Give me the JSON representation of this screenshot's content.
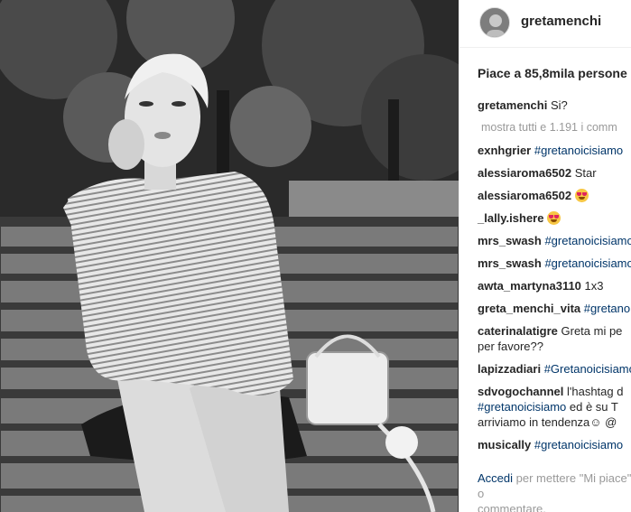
{
  "photo": {
    "alt_subject": "woman-on-bench-photo"
  },
  "post": {
    "username": "gretamenchi",
    "likes_text": "Piace a 85,8mila persone"
  },
  "comments": {
    "caption_user": "gretamenchi",
    "caption_text": "Si?",
    "more_text": "mostra tutti e 1.191 i comm",
    "items": [
      {
        "user": "exnhgrier",
        "hashtag": "#gretanoicisiamo",
        "text": ""
      },
      {
        "user": "alessiaroma6502",
        "hashtag": "",
        "text": "Star"
      },
      {
        "user": "alessiaroma6502",
        "hashtag": "",
        "text": "",
        "emoji": "heart-eyes-emoji"
      },
      {
        "user": "_lally.ishere",
        "hashtag": "",
        "text": "",
        "emoji": "heart-eyes-emoji"
      },
      {
        "user": "mrs_swash",
        "hashtag": "#gretanoicisiamo",
        "text": ""
      },
      {
        "user": "mrs_swash",
        "hashtag": "#gretanoicisiamo",
        "text": ""
      },
      {
        "user": "awta_martyna3110",
        "hashtag": "",
        "text": "1x3"
      },
      {
        "user": "greta_menchi_vita",
        "hashtag": "#gretanoicisiamo",
        "text": ""
      },
      {
        "user": "caterinalatigre",
        "hashtag": "",
        "text": "Greta mi pe",
        "line2": "per favore??"
      },
      {
        "user": "lapizzadiari",
        "hashtag": "#Gretanoicisiamo",
        "text": ""
      },
      {
        "user": "sdvogochannel",
        "hashtag": "",
        "text": "l'hashtag d",
        "line2_hashtag": "#gretanoicisiamo",
        "line2": " ed è su T",
        "line3": "arriviamo in tendenza☺ @"
      },
      {
        "user": "musically",
        "hashtag": "#gretanoicisiamo",
        "text": ""
      }
    ]
  },
  "login": {
    "link": "Accedi",
    "text": " per mettere \"Mi piace\" o",
    "line2": "commentare."
  }
}
